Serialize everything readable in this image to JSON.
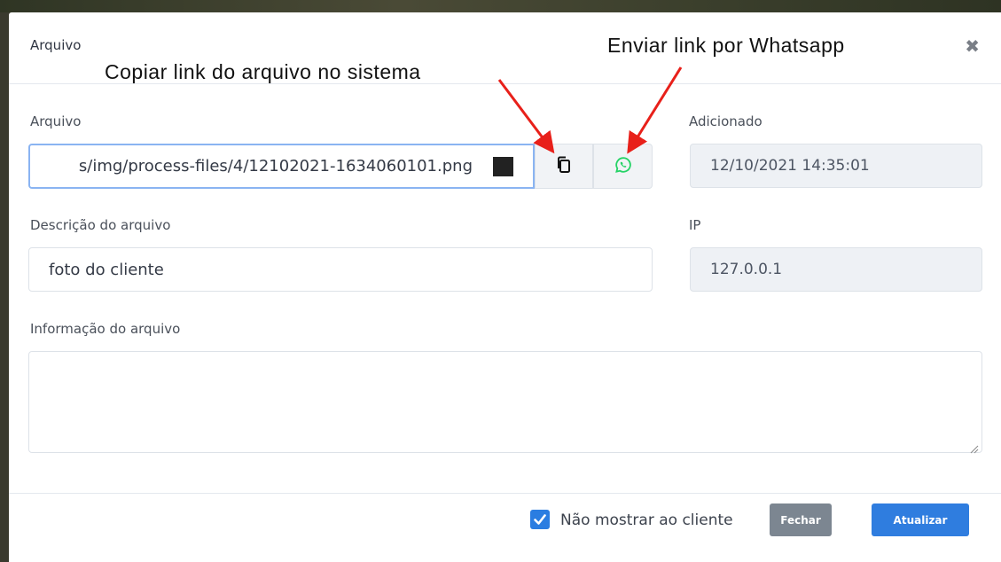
{
  "modal": {
    "title": "Arquivo",
    "close_symbol": "✖"
  },
  "fields": {
    "file": {
      "label": "Arquivo",
      "value": "s/img/process-files/4/12102021-1634060101.png",
      "copy_icon": "copy-icon",
      "whatsapp_icon": "whatsapp-icon"
    },
    "added": {
      "label": "Adicionado",
      "value": "12/10/2021 14:35:01"
    },
    "description": {
      "label": "Descrição do arquivo",
      "value": "foto do cliente"
    },
    "ip": {
      "label": "IP",
      "value": "127.0.0.1"
    },
    "info": {
      "label": "Informação do arquivo",
      "value": ""
    }
  },
  "footer": {
    "hide_from_client_label": "Não mostrar ao cliente",
    "hide_from_client_checked": true,
    "close_label": "Fechar",
    "update_label": "Atualizar"
  },
  "annotations": {
    "copy_link": "Copiar link do arquivo no sistema",
    "whatsapp_link": "Enviar link por Whatsapp"
  },
  "colors": {
    "primary": "#2f7ddf",
    "secondary": "#7c8691",
    "whatsapp": "#25d366",
    "arrow": "#e8201a"
  }
}
